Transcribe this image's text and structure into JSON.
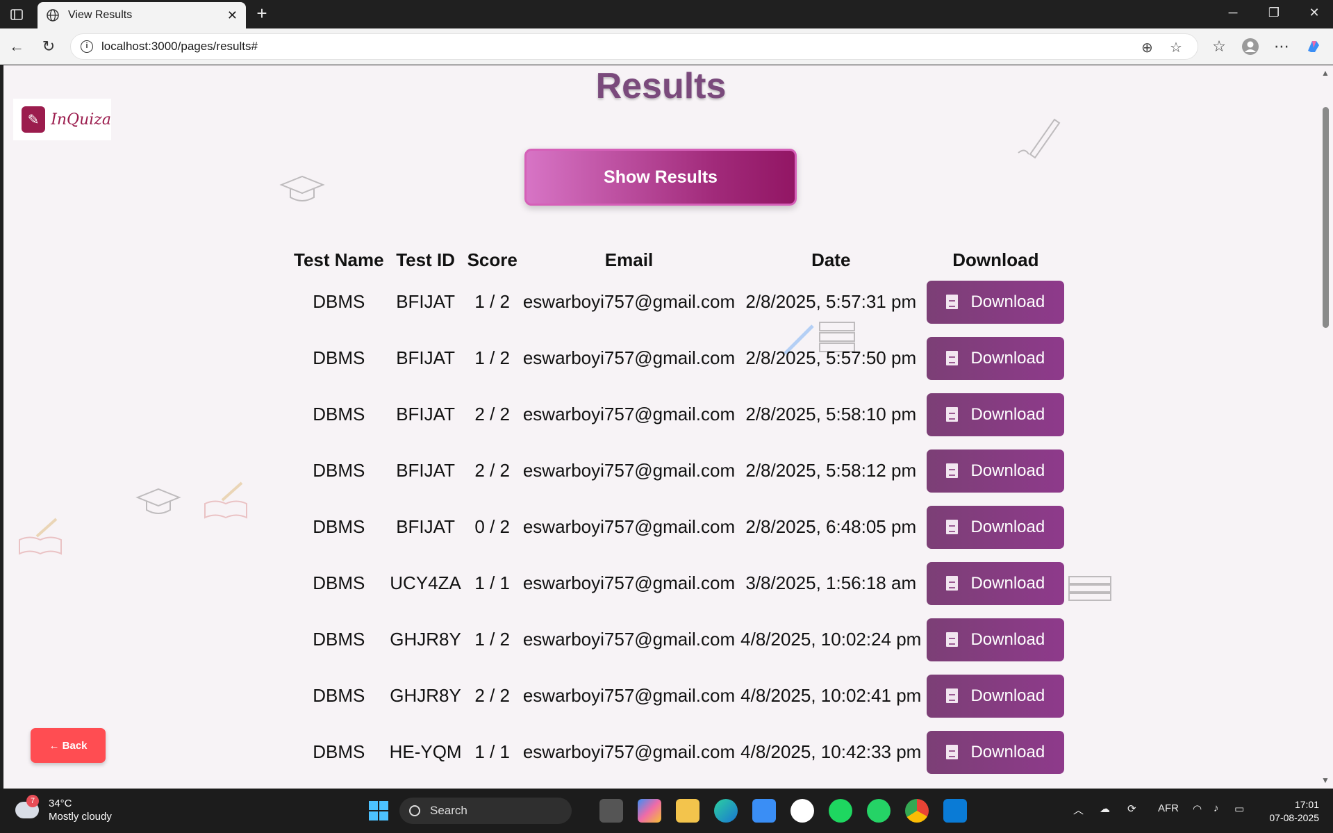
{
  "browser": {
    "tab_title": "View Results",
    "url": "localhost:3000/pages/results#"
  },
  "page": {
    "title": "Results",
    "logo_text": "InQuiza",
    "show_results_label": "Show Results",
    "back_label": "← Back",
    "download_label": "Download",
    "columns": [
      "Test Name",
      "Test ID",
      "Score",
      "Email",
      "Date",
      "Download"
    ],
    "rows": [
      {
        "test_name": "DBMS",
        "test_id": "BFIJAT",
        "score": "1 / 2",
        "email": "eswarboyi757@gmail.com",
        "date": "2/8/2025, 5:57:31 pm"
      },
      {
        "test_name": "DBMS",
        "test_id": "BFIJAT",
        "score": "1 / 2",
        "email": "eswarboyi757@gmail.com",
        "date": "2/8/2025, 5:57:50 pm"
      },
      {
        "test_name": "DBMS",
        "test_id": "BFIJAT",
        "score": "2 / 2",
        "email": "eswarboyi757@gmail.com",
        "date": "2/8/2025, 5:58:10 pm"
      },
      {
        "test_name": "DBMS",
        "test_id": "BFIJAT",
        "score": "2 / 2",
        "email": "eswarboyi757@gmail.com",
        "date": "2/8/2025, 5:58:12 pm"
      },
      {
        "test_name": "DBMS",
        "test_id": "BFIJAT",
        "score": "0 / 2",
        "email": "eswarboyi757@gmail.com",
        "date": "2/8/2025, 6:48:05 pm"
      },
      {
        "test_name": "DBMS",
        "test_id": "UCY4ZA",
        "score": "1 / 1",
        "email": "eswarboyi757@gmail.com",
        "date": "3/8/2025, 1:56:18 am"
      },
      {
        "test_name": "DBMS",
        "test_id": "GHJR8Y",
        "score": "1 / 2",
        "email": "eswarboyi757@gmail.com",
        "date": "4/8/2025, 10:02:24 pm"
      },
      {
        "test_name": "DBMS",
        "test_id": "GHJR8Y",
        "score": "2 / 2",
        "email": "eswarboyi757@gmail.com",
        "date": "4/8/2025, 10:02:41 pm"
      },
      {
        "test_name": "DBMS",
        "test_id": "HE-YQM",
        "score": "1 / 1",
        "email": "eswarboyi757@gmail.com",
        "date": "4/8/2025, 10:42:33 pm"
      }
    ]
  },
  "taskbar": {
    "weather_temp": "34°C",
    "weather_desc": "Mostly cloudy",
    "weather_badge": "7",
    "search_label": "Search",
    "language": "AFR",
    "time": "17:01",
    "date": "07-08-2025"
  },
  "colors": {
    "title": "#7a4a7c",
    "download_button": "#8e3a8b",
    "back_button": "#ff4d52",
    "show_button": "#a12a7a"
  }
}
